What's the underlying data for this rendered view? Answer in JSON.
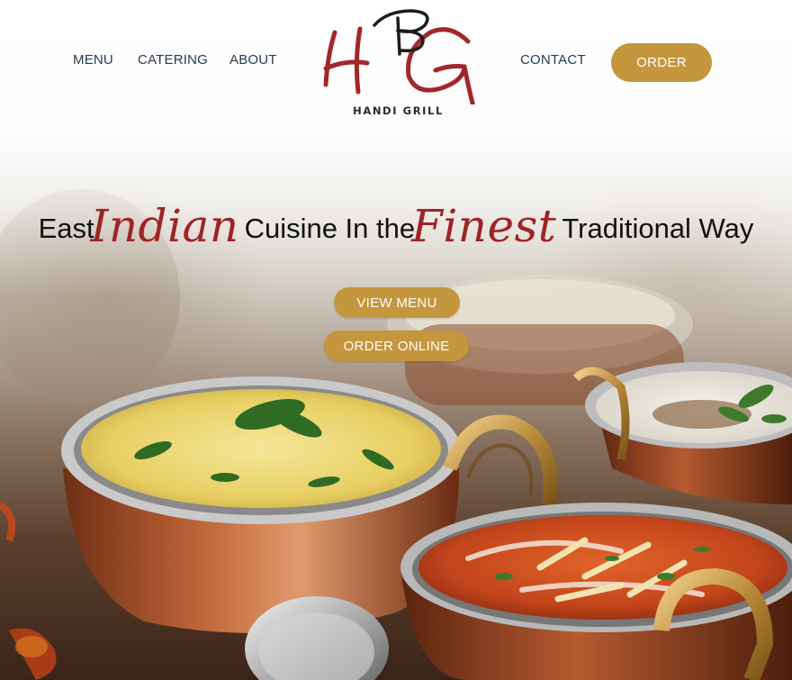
{
  "header": {
    "nav_left": [
      {
        "label": "MENU"
      },
      {
        "label": "CATERING"
      },
      {
        "label": "ABOUT"
      }
    ],
    "nav_right": [
      {
        "label": "CONTACT"
      }
    ],
    "order_label": "ORDER",
    "logo": {
      "monogram": "HG",
      "name": "HANDI GRILL",
      "accent_color": "#a3262a"
    }
  },
  "hero": {
    "headline": {
      "part1": "East",
      "script1": "Indian",
      "part2": "Cuisine In the",
      "script2": "Finest",
      "part3": "Traditional Way"
    },
    "view_menu_label": "VIEW MENU",
    "order_online_label": "ORDER ONLINE",
    "background": "photo of Indian dishes in copper handi bowls"
  },
  "colors": {
    "gold": "#c4963e",
    "script_red": "#9e2424",
    "nav_text": "#2a3b4c"
  }
}
